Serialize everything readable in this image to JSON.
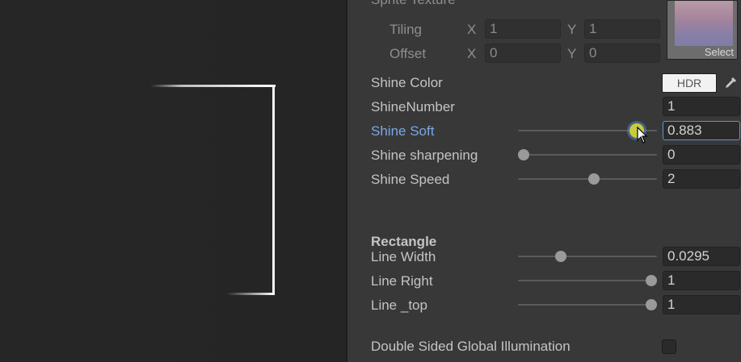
{
  "inspector": {
    "sprite_texture_label": "Sprite Texture",
    "texture_select_label": "Select",
    "tiling": {
      "label": "Tiling",
      "x_label": "X",
      "x_value": "1",
      "y_label": "Y",
      "y_value": "1"
    },
    "offset": {
      "label": "Offset",
      "x_label": "X",
      "x_value": "0",
      "y_label": "Y",
      "y_value": "0"
    },
    "shine_color": {
      "label": "Shine Color",
      "field_text": "HDR"
    },
    "shine_number": {
      "label": "ShineNumber",
      "value": "1"
    },
    "shine_soft": {
      "label": "Shine Soft",
      "value": "0.883",
      "slider_fraction": 0.883
    },
    "shine_sharpening": {
      "label": "Shine sharpening",
      "value": "0",
      "slider_fraction": 0.0
    },
    "shine_speed": {
      "label": "Shine Speed",
      "value": "2",
      "slider_fraction": 0.55
    },
    "rectangle_header": "Rectangle",
    "line_width": {
      "label": "Line Width",
      "value": "0.0295",
      "slider_fraction": 0.3
    },
    "line_right": {
      "label": "Line Right",
      "value": "1",
      "slider_fraction": 1.0
    },
    "line_top": {
      "label": "Line _top",
      "value": "1",
      "slider_fraction": 1.0
    },
    "double_sided_gi": {
      "label": "Double Sided Global Illumination",
      "checked": false
    }
  },
  "colors": {
    "active_label": "#79a8e6",
    "focused_border": "#5c95d6",
    "active_thumb": "#c7cc3a"
  },
  "icons": {
    "eyedropper": "eyedropper-icon",
    "cursor": "mouse-cursor-icon"
  }
}
